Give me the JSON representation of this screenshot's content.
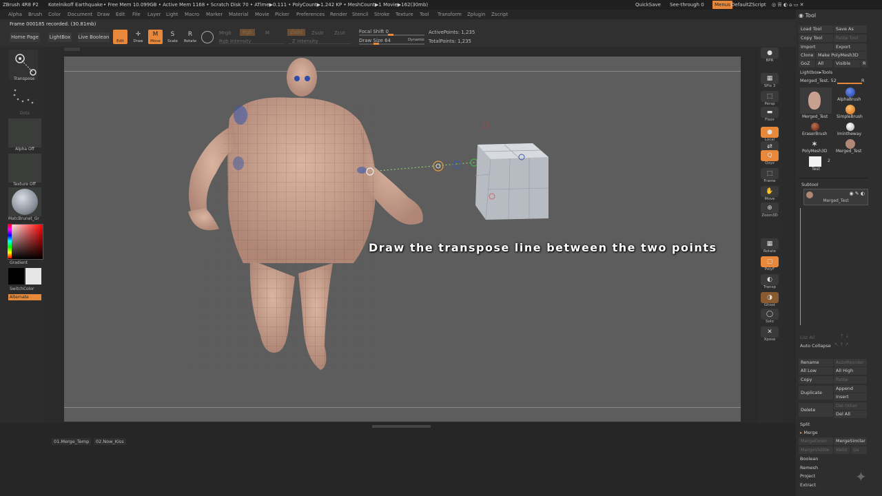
{
  "titlebar": {
    "app": "ZBrush 4R8 P2",
    "project": "Kotelnikoff Earthquake",
    "stats": "• Free Mem 10.099GB • Active Mem 1168 • Scratch Disk 70 • ATime▶0.111 • PolyCount▶1.242 KP • MeshCount▶1 Movie▶162(30mb)",
    "quicksave": "QuickSave",
    "seethrough": "See-through  0",
    "menus": "Menus",
    "script": "DefaultZScript"
  },
  "menubar": [
    "Alpha",
    "Brush",
    "Color",
    "Document",
    "Draw",
    "Edit",
    "File",
    "Layer",
    "Light",
    "Macro",
    "Marker",
    "Material",
    "Movie",
    "Picker",
    "Preferences",
    "Render",
    "Stencil",
    "Stroke",
    "Texture",
    "Tool",
    "Transform",
    "Zplugin",
    "Zscript"
  ],
  "frame_note": "Frame 000185 recorded. (30.81mb)",
  "topshelf": {
    "home": "Home Page",
    "lightbox": "LightBox",
    "liveboolean": "Live Boolean",
    "edit": "Edit",
    "draw": "Draw",
    "move": "Move",
    "scale": "Scale",
    "rotate": "Rotate",
    "mrgb": "Mrgb",
    "rgb": "Rgb",
    "m": "M",
    "rgb_intensity": "Rgb Intensity",
    "zadd": "Zadd",
    "zsub": "Zsub",
    "zcut": "Zcut",
    "z_intensity": "Z Intensity",
    "focal_shift": "Focal Shift 0",
    "draw_size": "Draw Size 64",
    "dynamic": "Dynamic",
    "active_points": "ActivePoints: 1,235",
    "total_points": "TotalPoints: 1,235"
  },
  "leftshelf": {
    "transpose": "Transpose",
    "dots": "Dots",
    "alpha_off": "Alpha Off",
    "texture_off": "Texture Off",
    "material": "MatcBrunet_Gr",
    "gradient": "Gradient",
    "switchcolor": "SwitchColor",
    "alternate": "Alternate"
  },
  "rightshelf": [
    "BPR",
    "SPix 3",
    "Persp",
    "Floor",
    "Local",
    "L.Sym",
    "Qxyz",
    "Frame",
    "Move",
    "Zoom3D",
    "Rotate",
    "PolyF",
    "Transp",
    "Ghost",
    "Solo",
    "Xpose"
  ],
  "caption": "Draw the transpose line between the two points",
  "tray": {
    "title": "Tool",
    "load_tool": "Load Tool",
    "save_as": "Save As",
    "copy_tool": "Copy Tool",
    "paste_tool": "Paste Tool",
    "import": "Import",
    "export": "Export",
    "clone": "Clone",
    "make_polymesh": "Make PolyMesh3D",
    "goz": "GoZ",
    "all": "All",
    "visible": "Visible",
    "r": "R",
    "lightbox_tools": "Lightbox▸Tools",
    "merged_test_slider": "Merged_Test. 52",
    "tools": [
      "Merged_Test",
      "AlphaBrush",
      "SimpleBrush",
      "EraserBrush",
      "Imintheway",
      "PolyMesh3D",
      "Merged_Test",
      "Test"
    ],
    "tool_count": "2",
    "subtool_title": "Subtool",
    "subtool_item": "Merged_Test",
    "list_all": "List All",
    "auto_collapse": "Auto Collapse",
    "rename": "Rename",
    "autoreorder": "AutoReorder",
    "all_low": "All Low",
    "all_high": "All High",
    "copy": "Copy",
    "paste": "Paste",
    "duplicate": "Duplicate",
    "append": "Append",
    "insert": "Insert",
    "delete": "Delete",
    "del_other": "Del Other",
    "del_all": "Del All",
    "split": "Split",
    "merge": "Merge",
    "mergedown": "MergeDown",
    "mergesimilar": "MergeSimilar",
    "mergevisible": "MergeVisible",
    "weld": "Weld",
    "uv": "Uv",
    "boolean": "Boolean",
    "remesh": "Remesh",
    "project": "Project",
    "extract": "Extract"
  },
  "bottom": {
    "tabs": [
      "01.Merge_Temp",
      "02.Now_Kiss"
    ]
  }
}
